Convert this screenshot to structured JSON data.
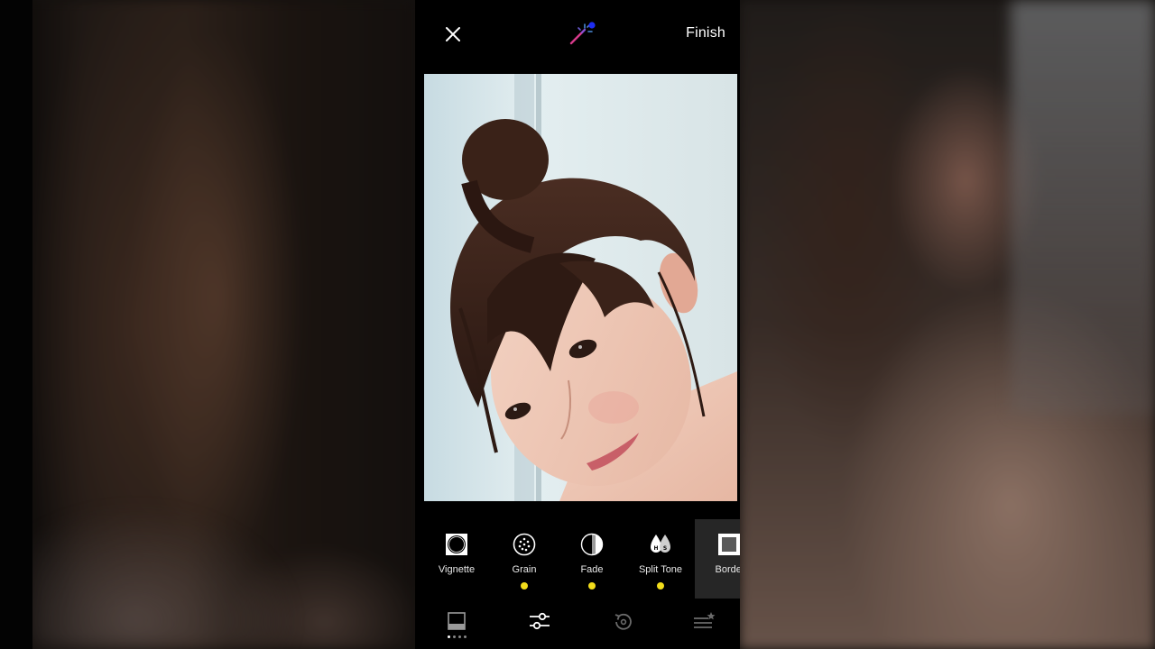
{
  "topbar": {
    "finish_label": "Finish",
    "close_icon": "close-icon",
    "wand_icon": "magic-wand-icon"
  },
  "tools": [
    {
      "label": "Vignette",
      "icon": "vignette-icon",
      "applied": false,
      "active": false
    },
    {
      "label": "Grain",
      "icon": "grain-icon",
      "applied": true,
      "active": false
    },
    {
      "label": "Fade",
      "icon": "fade-icon",
      "applied": true,
      "active": false
    },
    {
      "label": "Split Tone",
      "icon": "split-tone-icon",
      "applied": true,
      "active": false
    },
    {
      "label": "Border",
      "icon": "border-icon",
      "applied": false,
      "active": true
    }
  ],
  "bottom_nav": [
    {
      "icon": "presets-icon",
      "active": false
    },
    {
      "icon": "adjust-sliders-icon",
      "active": true
    },
    {
      "icon": "history-icon",
      "active": false
    },
    {
      "icon": "recipes-icon",
      "active": false
    }
  ],
  "colors": {
    "applied_dot": "#f2dd1b",
    "background": "#000000",
    "active_tool_bg": "#262626",
    "text": "#ffffff"
  }
}
